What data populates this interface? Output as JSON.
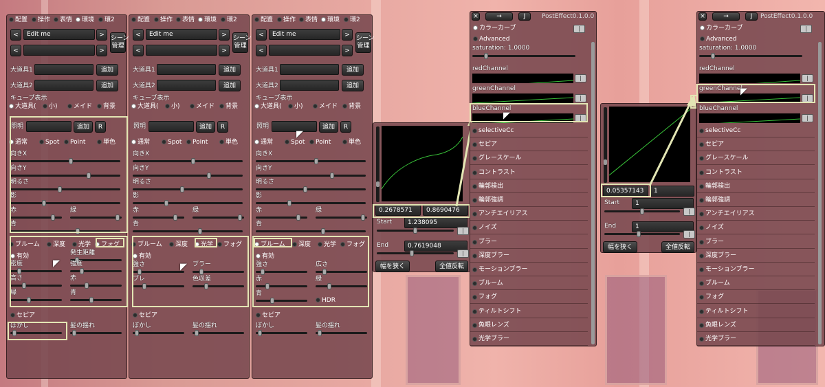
{
  "bg": {
    "accent": "#e3e6b4"
  },
  "left_panels": [
    {
      "tabs": [
        "配置",
        "操作",
        "表情",
        "環境",
        "環2"
      ],
      "active_tab": 3,
      "scene_name": "Edit me",
      "scene_btn": "シーン\n管理",
      "room": "キッチン",
      "prop1_label": "大道具1",
      "prop1_value": "ソファー",
      "prop2_label": "大道具2",
      "prop2_value": "鏡",
      "add_label": "追加",
      "cube_label": "キューブ表示",
      "cube_opts": [
        "大道具(",
        "小)",
        "メイド",
        "背景"
      ],
      "light_label": "照明",
      "light_value": "メイン",
      "light_add": "追加",
      "light_r": "R",
      "light_modes": [
        "通常",
        "Spot",
        "Point",
        "単色"
      ],
      "sliders": [
        "向きX",
        "向きY",
        "明るさ",
        "影",
        "赤",
        "緑",
        "青"
      ],
      "effect_tabs": [
        "ブルーム",
        "深度",
        "光学",
        "フォグ"
      ],
      "effect_active": 3,
      "effect_checkbox": "有効",
      "effect_params": [
        "発生距離",
        "密度",
        "強度",
        "高さ",
        "赤",
        "緑",
        "青"
      ],
      "sepia": "セピア",
      "blur": "ぼかし",
      "hair": "髪の揺れ"
    },
    {
      "tabs": [
        "配置",
        "操作",
        "表情",
        "環境",
        "環2"
      ],
      "active_tab": 3,
      "scene_name": "Edit me",
      "scene_btn": "シーン\n管理",
      "room": "キッチン",
      "prop1_label": "大道具1",
      "prop1_value": "ソファー",
      "prop2_label": "大道具2",
      "prop2_value": "鏡",
      "add_label": "追加",
      "cube_label": "キューブ表示",
      "cube_opts": [
        "大道具(",
        "小)",
        "メイド",
        "背景"
      ],
      "light_label": "照明",
      "light_value": "メイン",
      "light_add": "追加",
      "light_r": "R",
      "light_modes": [
        "通常",
        "Spot",
        "Point",
        "単色"
      ],
      "sliders": [
        "向きX",
        "向きY",
        "明るさ",
        "影",
        "赤",
        "緑",
        "青"
      ],
      "effect_tabs": [
        "ブルーム",
        "深度",
        "光学",
        "フォグ"
      ],
      "effect_active": 2,
      "effect_checkbox": "有効",
      "effect_params": [
        "強さ",
        "ブラー",
        "ブレ",
        "色収差"
      ],
      "sepia": "セピア",
      "blur": "ぼかし",
      "hair": "髪の揺れ"
    },
    {
      "tabs": [
        "配置",
        "操作",
        "表情",
        "環境",
        "環2"
      ],
      "active_tab": 3,
      "scene_name": "Edit me",
      "scene_btn": "シーン\n管理",
      "room": "キッチン",
      "prop1_label": "大道具1",
      "prop1_value": "ソファー",
      "prop2_label": "大道具2",
      "prop2_value": "鏡",
      "add_label": "追加",
      "cube_label": "キューブ表示",
      "cube_opts": [
        "大道具(",
        "小)",
        "メイド",
        "背景"
      ],
      "light_label": "照明",
      "light_value": "メイン",
      "light_add": "追加",
      "light_r": "R",
      "light_modes": [
        "通常",
        "Spot",
        "Point",
        "単色"
      ],
      "sliders": [
        "向きX",
        "向きY",
        "明るさ",
        "影",
        "赤",
        "緑",
        "青"
      ],
      "effect_tabs": [
        "ブルーム",
        "深度",
        "光学",
        "フォグ"
      ],
      "effect_active": 0,
      "effect_checkbox": "有効",
      "effect_params": [
        "強さ",
        "広さ",
        "赤",
        "緑",
        "青",
        "HDR"
      ],
      "sepia": "セピア",
      "blur": "ぼかし",
      "hair": "髪の揺れ"
    }
  ],
  "curve_popups": [
    {
      "val1": "0.2678571",
      "val2": "0.8690476",
      "start_label": "Start",
      "start": "1.238095",
      "end_label": "End",
      "end": "0.7619048",
      "narrow": "幅を狭く",
      "invert": "全値反転"
    },
    {
      "val1": "0.05357143",
      "val2": "1",
      "start_label": "Start",
      "start": "1",
      "end_label": "End",
      "end": "1",
      "narrow": "幅を狭く",
      "invert": "全値反転"
    }
  ],
  "posteffect": {
    "close": "×",
    "arrow": "→",
    "j": "J",
    "title": "PostEffect0.1.0.0",
    "curve": "カラーカーブ",
    "advanced": "Advanced",
    "saturation": "saturation: 1.0000",
    "red": "redChannel",
    "green": "greenChannel",
    "blue": "blueChannel",
    "items": [
      "selectiveCc",
      "セピア",
      "グレースケール",
      "コントラスト",
      "輪郭検出",
      "輪郭強調",
      "アンチエイリアス",
      "ノイズ",
      "ブラー",
      "深度ブラー",
      "モーションブラー",
      "ブルーム",
      "フォグ",
      "ティルトシフト",
      "魚眼レンズ",
      "光学ブラー"
    ]
  }
}
